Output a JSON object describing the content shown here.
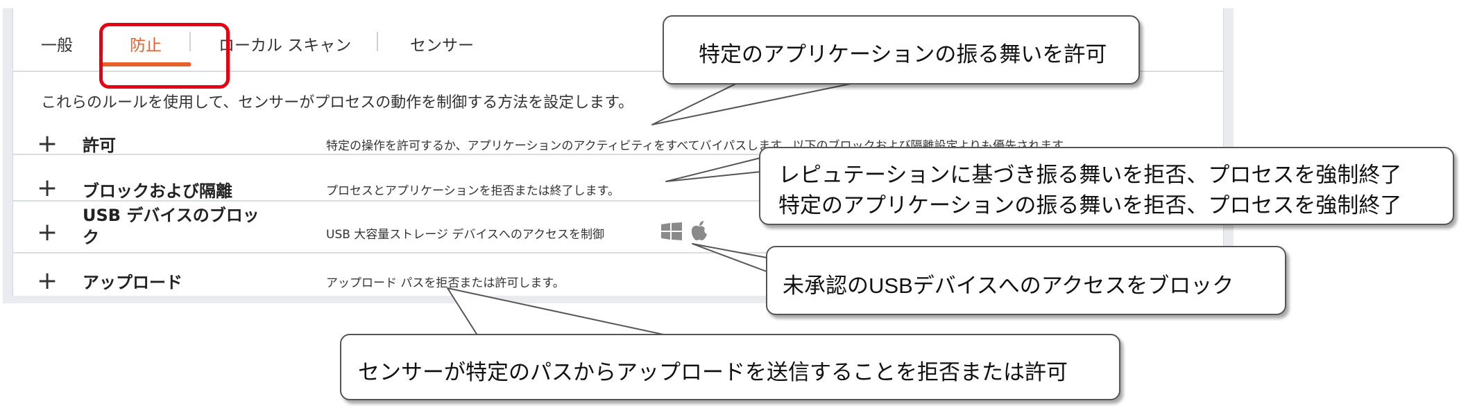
{
  "tabs": [
    {
      "label": "一般",
      "active": false
    },
    {
      "label": "防止",
      "active": true
    },
    {
      "label": "ローカル スキャン",
      "active": false
    },
    {
      "label": "センサー",
      "active": false
    }
  ],
  "intro_text": "これらのルールを使用して、センサーがプロセスの動作を制御する方法を設定します。",
  "rules": [
    {
      "expand": "+",
      "title": "許可",
      "description": "特定の操作を許可するか、アプリケーションのアクティビティをすべてバイパスします。以下のブロックおよび隔離設定よりも優先されます。"
    },
    {
      "expand": "+",
      "title": "ブロックおよび隔離",
      "description": "プロセスとアプリケーションを拒否または終了します。"
    },
    {
      "expand": "+",
      "title": "USB デバイスのブロック",
      "description": "USB 大容量ストレージ デバイスへのアクセスを制御",
      "icons": [
        "windows-icon",
        "apple-icon"
      ]
    },
    {
      "expand": "+",
      "title": "アップロード",
      "description": "アップロード パスを拒否または許可します。"
    }
  ],
  "callouts": {
    "allow": "特定のアプリケーションの振る舞いを許可",
    "block_line1": "レピュテーションに基づき振る舞いを拒否、プロセスを強制終了",
    "block_line2": "特定のアプリケーションの振る舞いを拒否、プロセスを強制終了",
    "usb": "未承認のUSBデバイスへのアクセスをブロック",
    "upload": "センサーが特定のパスからアップロードを送信することを拒否または許可"
  },
  "colors": {
    "accent": "#e8612c",
    "highlight": "#e60012",
    "panel_bg": "#e9ebee"
  }
}
